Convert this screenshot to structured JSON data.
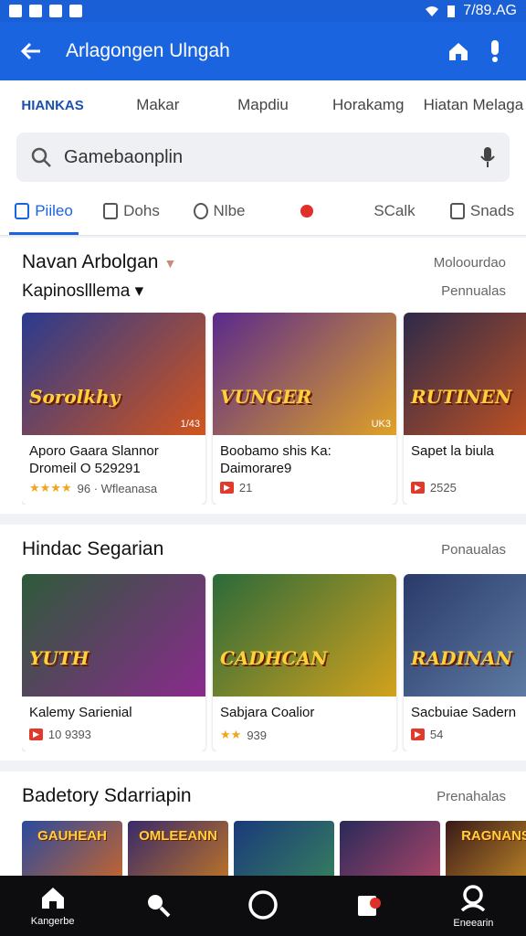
{
  "status": {
    "time": "7/89.AG"
  },
  "app_bar": {
    "title": "Arlagongen Ulngah"
  },
  "top_tabs": [
    "HIANKAS",
    "Makar",
    "Mapdiu",
    "Horakamg",
    "Hiatan Melaga"
  ],
  "search": {
    "placeholder": "Gamebaonplin"
  },
  "chips": [
    {
      "label": "Piileo",
      "icon": "video-icon"
    },
    {
      "label": "Dohs",
      "icon": "bookmark-icon"
    },
    {
      "label": "Nlbe",
      "icon": "shield-icon"
    },
    {
      "label": "",
      "icon": "pin-icon"
    },
    {
      "label": "SCalk",
      "icon": ""
    },
    {
      "label": "Snads",
      "icon": "plus-square-icon"
    }
  ],
  "sections": [
    {
      "title": "Navan Arbolgan",
      "link": "Moloourdao",
      "subtitle": "Kapinoslllema",
      "sublink": "Pennualas",
      "cards": [
        {
          "logo": "Sorolkhy",
          "badge": "1/43",
          "name": "Aporo Gaara Slannor Dromeil O 529291",
          "meta": "96 · Wfleanasa",
          "rating": "★★★★",
          "colors": [
            "#2a3a8f",
            "#d2551c"
          ]
        },
        {
          "logo": "VUNGER",
          "badge": "UK3",
          "name": "Boobamo shis Ka: Daimorare9",
          "meta": "21",
          "rating": "",
          "colors": [
            "#5a2a8c",
            "#e0a226"
          ]
        },
        {
          "logo": "RUTINEN",
          "badge": "",
          "name": "Sapet la biula",
          "meta": "2525",
          "rating": "",
          "colors": [
            "#2d2a4a",
            "#e05a1a"
          ]
        }
      ]
    },
    {
      "title": "Hindac Segarian",
      "link": "Ponaualas",
      "subtitle": "",
      "sublink": "",
      "cards": [
        {
          "logo": "YUTH",
          "badge": "",
          "name": "Kalemy Sarienial",
          "meta": "10 9393",
          "rating": "",
          "colors": [
            "#2e5a3a",
            "#8a2a8c"
          ]
        },
        {
          "logo": "CADHCAN",
          "badge": "",
          "name": "Sabjara Coalior",
          "meta": "939",
          "rating": "★★",
          "colors": [
            "#2a6a3a",
            "#d2a21c"
          ]
        },
        {
          "logo": "RADINAN",
          "badge": "",
          "name": "Sacbuiae Sadern",
          "meta": "54",
          "rating": "",
          "colors": [
            "#2a3a6a",
            "#6a8ab0"
          ]
        }
      ]
    },
    {
      "title": "Badetory Sdarriapin",
      "link": "Prenahalas",
      "subtitle": "",
      "sublink": "",
      "minis": [
        {
          "logo": "GAUHEAH",
          "colors": [
            "#2a4a9f",
            "#e06a1a"
          ]
        },
        {
          "logo": "OMLEEANN",
          "colors": [
            "#3a2a6a",
            "#d2801c"
          ]
        },
        {
          "logo": "",
          "colors": [
            "#1a3a7a",
            "#3a8a5a"
          ]
        },
        {
          "logo": "",
          "colors": [
            "#2a2a5a",
            "#c04a6a"
          ]
        },
        {
          "logo": "RAGNANS",
          "colors": [
            "#3a1a1a",
            "#e0a22a"
          ]
        }
      ]
    }
  ],
  "bottom_nav": [
    {
      "label": "Kangerbe",
      "icon": "home-icon"
    },
    {
      "label": "",
      "icon": "search-icon"
    },
    {
      "label": "",
      "icon": "circle-icon"
    },
    {
      "label": "",
      "icon": "library-icon"
    },
    {
      "label": "Eneearin",
      "icon": "profile-icon"
    }
  ],
  "colors": {
    "primary": "#1b64e0",
    "accent_red": "#e0302a"
  }
}
